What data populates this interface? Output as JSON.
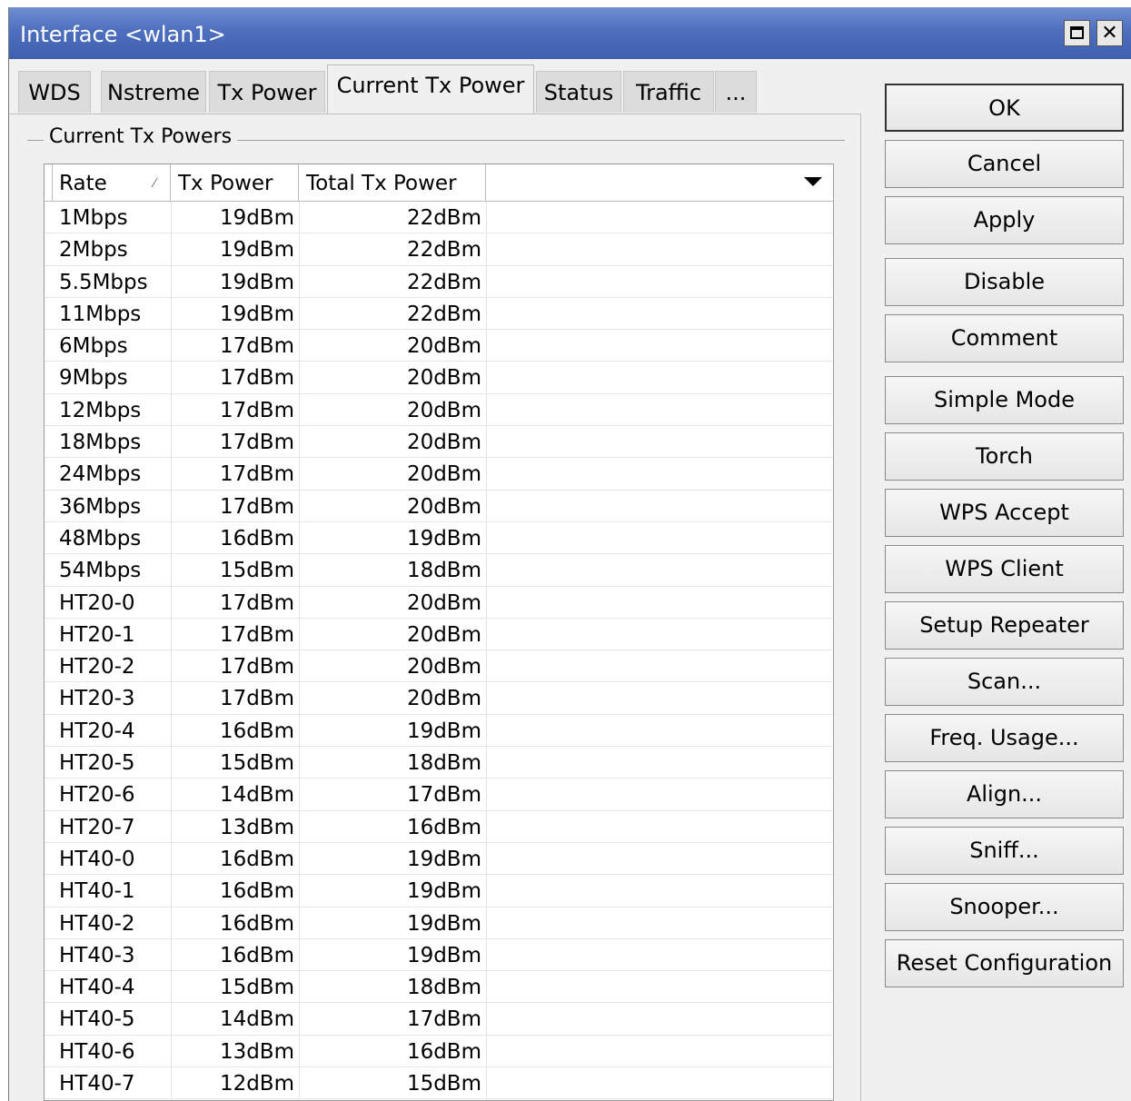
{
  "window": {
    "title": "Interface <wlan1>"
  },
  "tabs": [
    {
      "label": "WDS"
    },
    {
      "label": "Nstreme"
    },
    {
      "label": "Tx Power"
    },
    {
      "label": "Current Tx Power"
    },
    {
      "label": "Status"
    },
    {
      "label": "Traffic"
    },
    {
      "label": "..."
    }
  ],
  "active_tab": "Current Tx Power",
  "group": {
    "label": "Current Tx Powers"
  },
  "table": {
    "columns": [
      "Rate",
      "Tx Power",
      "Total Tx Power"
    ],
    "sorted_by": "Rate",
    "rows": [
      [
        "1Mbps",
        "19dBm",
        "22dBm"
      ],
      [
        "2Mbps",
        "19dBm",
        "22dBm"
      ],
      [
        "5.5Mbps",
        "19dBm",
        "22dBm"
      ],
      [
        "11Mbps",
        "19dBm",
        "22dBm"
      ],
      [
        "6Mbps",
        "17dBm",
        "20dBm"
      ],
      [
        "9Mbps",
        "17dBm",
        "20dBm"
      ],
      [
        "12Mbps",
        "17dBm",
        "20dBm"
      ],
      [
        "18Mbps",
        "17dBm",
        "20dBm"
      ],
      [
        "24Mbps",
        "17dBm",
        "20dBm"
      ],
      [
        "36Mbps",
        "17dBm",
        "20dBm"
      ],
      [
        "48Mbps",
        "16dBm",
        "19dBm"
      ],
      [
        "54Mbps",
        "15dBm",
        "18dBm"
      ],
      [
        "HT20-0",
        "17dBm",
        "20dBm"
      ],
      [
        "HT20-1",
        "17dBm",
        "20dBm"
      ],
      [
        "HT20-2",
        "17dBm",
        "20dBm"
      ],
      [
        "HT20-3",
        "17dBm",
        "20dBm"
      ],
      [
        "HT20-4",
        "16dBm",
        "19dBm"
      ],
      [
        "HT20-5",
        "15dBm",
        "18dBm"
      ],
      [
        "HT20-6",
        "14dBm",
        "17dBm"
      ],
      [
        "HT20-7",
        "13dBm",
        "16dBm"
      ],
      [
        "HT40-0",
        "16dBm",
        "19dBm"
      ],
      [
        "HT40-1",
        "16dBm",
        "19dBm"
      ],
      [
        "HT40-2",
        "16dBm",
        "19dBm"
      ],
      [
        "HT40-3",
        "16dBm",
        "19dBm"
      ],
      [
        "HT40-4",
        "15dBm",
        "18dBm"
      ],
      [
        "HT40-5",
        "14dBm",
        "17dBm"
      ],
      [
        "HT40-6",
        "13dBm",
        "16dBm"
      ],
      [
        "HT40-7",
        "12dBm",
        "15dBm"
      ]
    ]
  },
  "buttons": [
    {
      "label": "OK",
      "name": "ok-button"
    },
    {
      "label": "Cancel",
      "name": "cancel-button"
    },
    {
      "label": "Apply",
      "name": "apply-button"
    },
    {
      "label": "Disable",
      "name": "disable-button"
    },
    {
      "label": "Comment",
      "name": "comment-button"
    },
    {
      "label": "Simple Mode",
      "name": "simple-mode-button"
    },
    {
      "label": "Torch",
      "name": "torch-button"
    },
    {
      "label": "WPS Accept",
      "name": "wps-accept-button"
    },
    {
      "label": "WPS Client",
      "name": "wps-client-button"
    },
    {
      "label": "Setup Repeater",
      "name": "setup-repeater-button"
    },
    {
      "label": "Scan...",
      "name": "scan-button"
    },
    {
      "label": "Freq. Usage...",
      "name": "freq-usage-button"
    },
    {
      "label": "Align...",
      "name": "align-button"
    },
    {
      "label": "Sniff...",
      "name": "sniff-button"
    },
    {
      "label": "Snooper...",
      "name": "snooper-button"
    },
    {
      "label": "Reset Configuration",
      "name": "reset-configuration-button"
    }
  ],
  "icons": {
    "maximize": "maximize-icon",
    "close": "close-icon",
    "column_menu": "chevron-down-icon",
    "sort": "sort-indicator-icon"
  }
}
